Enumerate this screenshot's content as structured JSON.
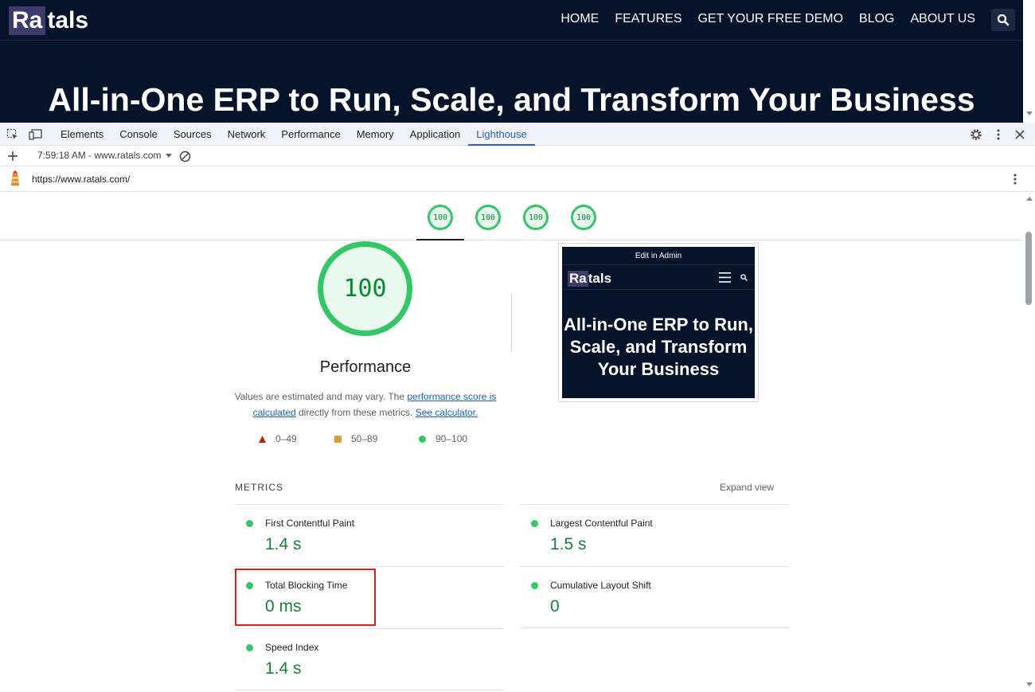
{
  "site": {
    "logo_box": "Ra",
    "logo_rest": "tals",
    "nav": [
      "HOME",
      "FEATURES",
      "GET YOUR FREE DEMO",
      "BLOG",
      "ABOUT US"
    ],
    "hero_title": "All-in-One ERP to Run, Scale, and Transform Your Business"
  },
  "devtools": {
    "tabs": [
      "Elements",
      "Console",
      "Sources",
      "Network",
      "Performance",
      "Memory",
      "Application",
      "Lighthouse"
    ],
    "active_tab": "Lighthouse",
    "report_selector": "7:59:18 AM - www.ratals.com",
    "url": "https://www.ratals.com/"
  },
  "summary": {
    "scores": [
      "100",
      "100",
      "100",
      "100"
    ]
  },
  "performance": {
    "score": "100",
    "title": "Performance",
    "desc_prefix": "Values are estimated and may vary. The ",
    "link_score": "performance score is calculated",
    "desc_mid": " directly from these metrics. ",
    "link_calc": "See calculator.",
    "legend": [
      "0–49",
      "50–89",
      "90–100"
    ],
    "colors": {
      "good": "#33c765",
      "average": "#d4a33a",
      "fail": "#b3261e"
    }
  },
  "thumbnail": {
    "admin": "Edit in Admin",
    "logo_box": "Ra",
    "logo_rest": "tals",
    "hero": "All-in-One ERP to Run, Scale, and Transform Your Business"
  },
  "metrics": {
    "label": "METRICS",
    "expand": "Expand view",
    "items": [
      {
        "name": "First Contentful Paint",
        "value": "1.4 s"
      },
      {
        "name": "Largest Contentful Paint",
        "value": "1.5 s"
      },
      {
        "name": "Total Blocking Time",
        "value": "0 ms"
      },
      {
        "name": "Cumulative Layout Shift",
        "value": "0"
      },
      {
        "name": "Speed Index",
        "value": "1.4 s"
      }
    ]
  }
}
